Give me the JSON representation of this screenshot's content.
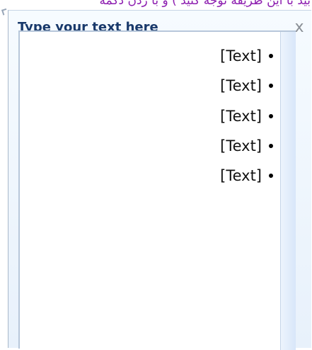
{
  "banner": {
    "text": "بید با این طریقه توجه کنید ) و با زدن دکمه"
  },
  "text_pane": {
    "title": "Type your text here",
    "close_label": "x",
    "items": [
      {
        "text": "[Text]"
      },
      {
        "text": "[Text]"
      },
      {
        "text": "[Text]"
      },
      {
        "text": "[Text]"
      },
      {
        "text": "[Text]"
      }
    ]
  },
  "colors": {
    "banner_text": "#8d1fb0",
    "title_text": "#19396b",
    "pane_border": "#b7c7da",
    "scroll_track": "#d8e6f9"
  },
  "icons": {
    "close": "close-icon",
    "bullet": "bullet-icon"
  }
}
